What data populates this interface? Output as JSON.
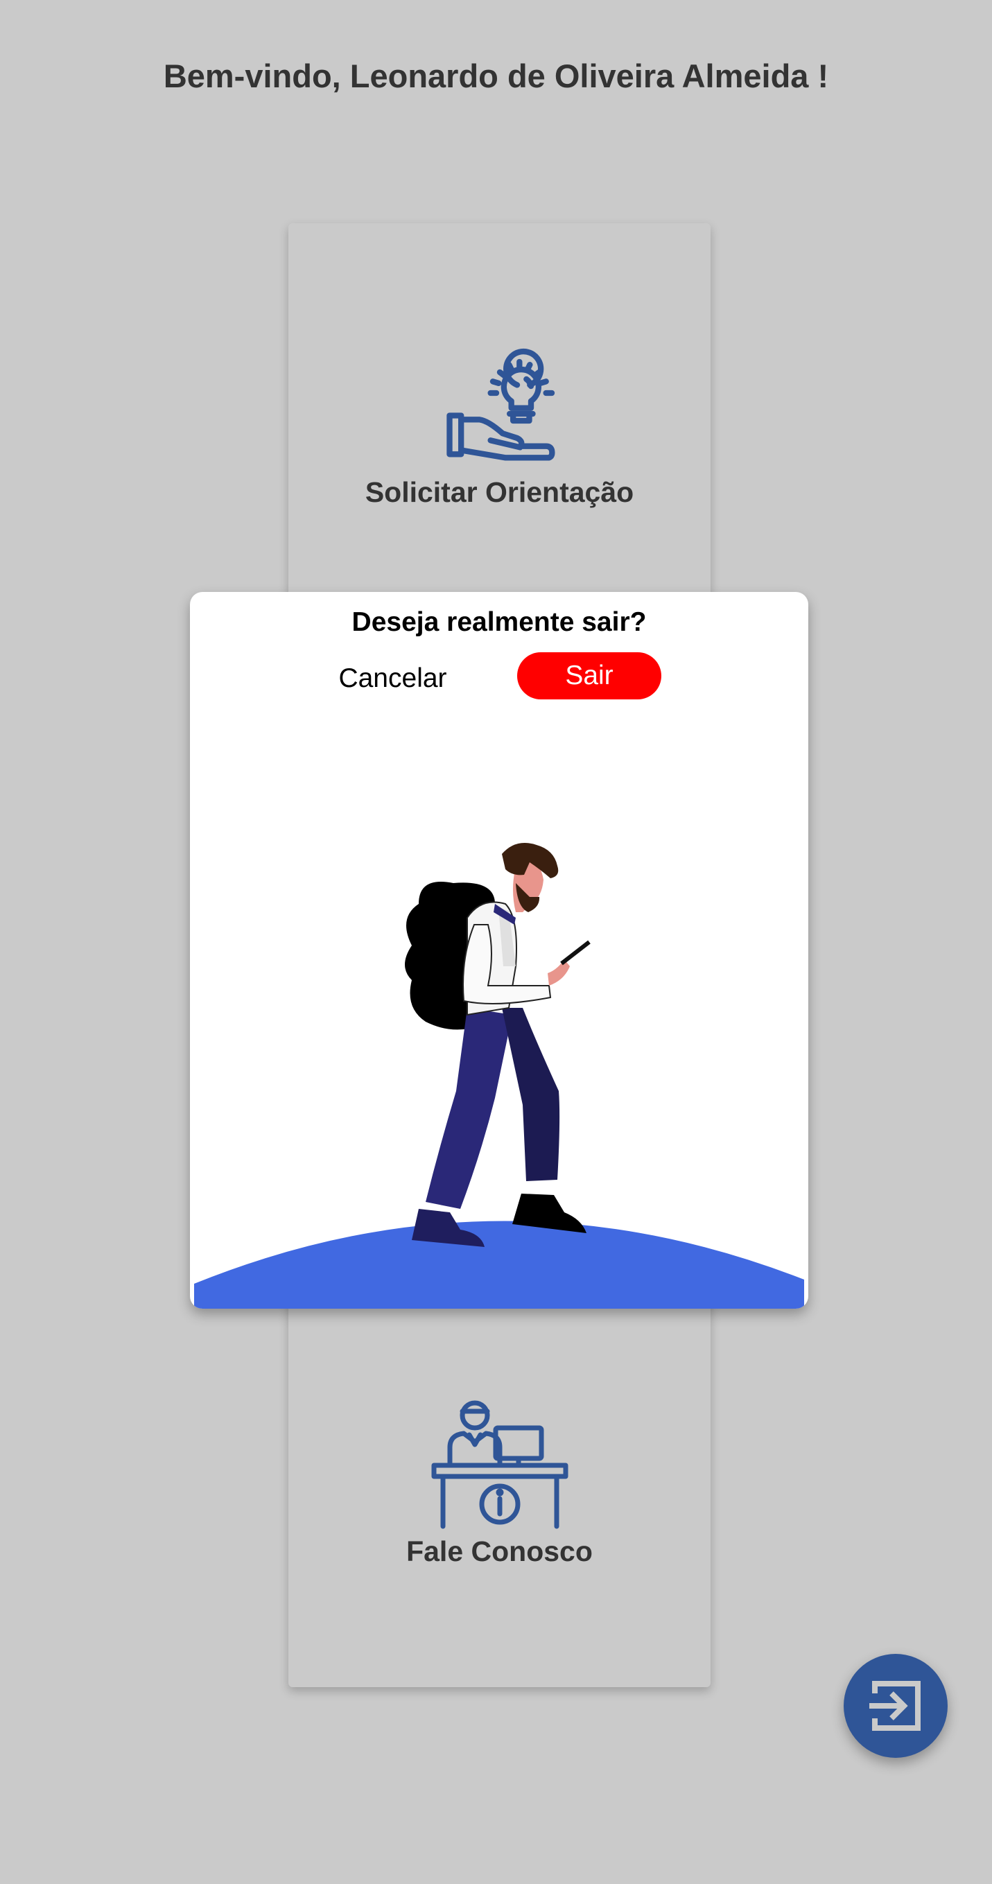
{
  "header": {
    "welcome": "Bem-vindo, Leonardo de Oliveira Almeida !"
  },
  "menu": {
    "items": [
      {
        "label": "Solicitar Orientação",
        "icon": "hand-lightbulb-icon"
      },
      {
        "label": "Fale Conosco",
        "icon": "help-desk-icon"
      }
    ]
  },
  "dialog": {
    "title": "Deseja realmente sair?",
    "cancel_label": "Cancelar",
    "confirm_label": "Sair",
    "illustration": "hiker-with-backpack"
  },
  "fab": {
    "icon": "logout-icon"
  },
  "colors": {
    "primary": "#2f5597",
    "danger": "#ff0000",
    "background": "#cacaca",
    "ground": "#4169e1"
  }
}
